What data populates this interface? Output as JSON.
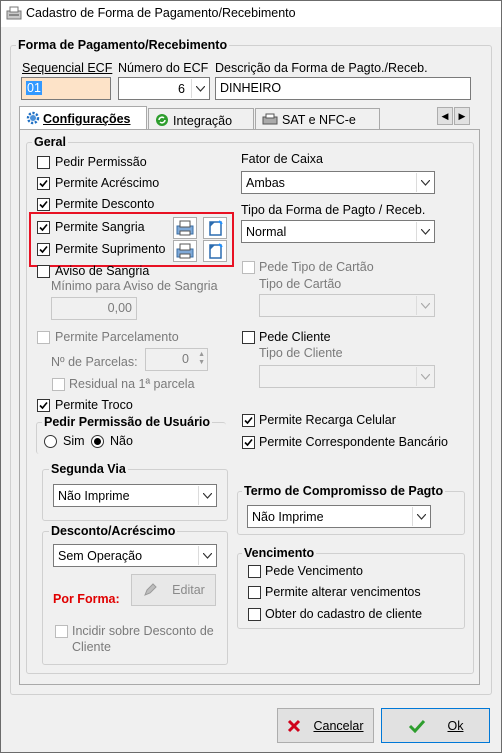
{
  "window": {
    "title": "Cadastro de Forma de Pagamento/Recebimento"
  },
  "header": {
    "group_title": "Forma de Pagamento/Recebimento",
    "seq_label": "Sequencial ECF",
    "seq_value": "01",
    "num_label": "Número do ECF",
    "num_value": "6",
    "desc_label": "Descrição da Forma de Pagto./Receb.",
    "desc_value": "DINHEIRO"
  },
  "tabs": [
    {
      "label": "Configurações",
      "active": true
    },
    {
      "label": "Integração",
      "active": false
    },
    {
      "label": "SAT e NFC-e",
      "active": false
    }
  ],
  "geral": {
    "title": "Geral",
    "pedir_permissao": "Pedir Permissão",
    "permite_acrescimo": "Permite Acréscimo",
    "permite_desconto": "Permite Desconto",
    "permite_sangria": "Permite Sangria",
    "permite_suprimento": "Permite Suprimento",
    "aviso_sangria": "Aviso de Sangria",
    "minimo_aviso_label": "Mínimo para Aviso de Sangria",
    "minimo_aviso_value": "0,00",
    "permite_parcelamento": "Permite Parcelamento",
    "num_parcelas_label": "Nº de Parcelas:",
    "num_parcelas_value": "0",
    "residual": "Residual na 1ª parcela",
    "permite_troco": "Permite Troco",
    "fator_caixa_label": "Fator de Caixa",
    "fator_caixa_value": "Ambas",
    "tipo_forma_label": "Tipo da Forma de Pagto / Receb.",
    "tipo_forma_value": "Normal",
    "pede_tipo_cartao": "Pede Tipo de Cartão",
    "tipo_cartao_label": "Tipo de Cartão",
    "pede_cliente": "Pede Cliente",
    "tipo_cliente_label": "Tipo de Cliente",
    "permite_recarga": "Permite Recarga Celular",
    "permite_correspondente": "Permite Correspondente Bancário"
  },
  "permissao_usuario": {
    "title": "Pedir Permissão de Usuário",
    "sim": "Sim",
    "nao": "Não"
  },
  "segunda_via": {
    "title": "Segunda Via",
    "value": "Não Imprime"
  },
  "termo": {
    "title": "Termo de Compromisso de Pagto",
    "value": "Não Imprime"
  },
  "desconto_acrescimo": {
    "title": "Desconto/Acréscimo",
    "value": "Sem Operação",
    "por_forma": "Por Forma:",
    "editar": "Editar",
    "incidir": "Incidir sobre Desconto de",
    "incidir2": "Cliente"
  },
  "vencimento": {
    "title": "Vencimento",
    "pede_vencimento": "Pede Vencimento",
    "permite_alterar": "Permite alterar vencimentos",
    "obter_cadastro": "Obter do cadastro de cliente"
  },
  "footer": {
    "cancelar": "Cancelar",
    "ok": "Ok"
  },
  "colors": {
    "highlight": "#e81123",
    "seq_bg": "#fde3c8",
    "check_ok": "#2e9e2e",
    "cancel_x": "#d0021b"
  }
}
